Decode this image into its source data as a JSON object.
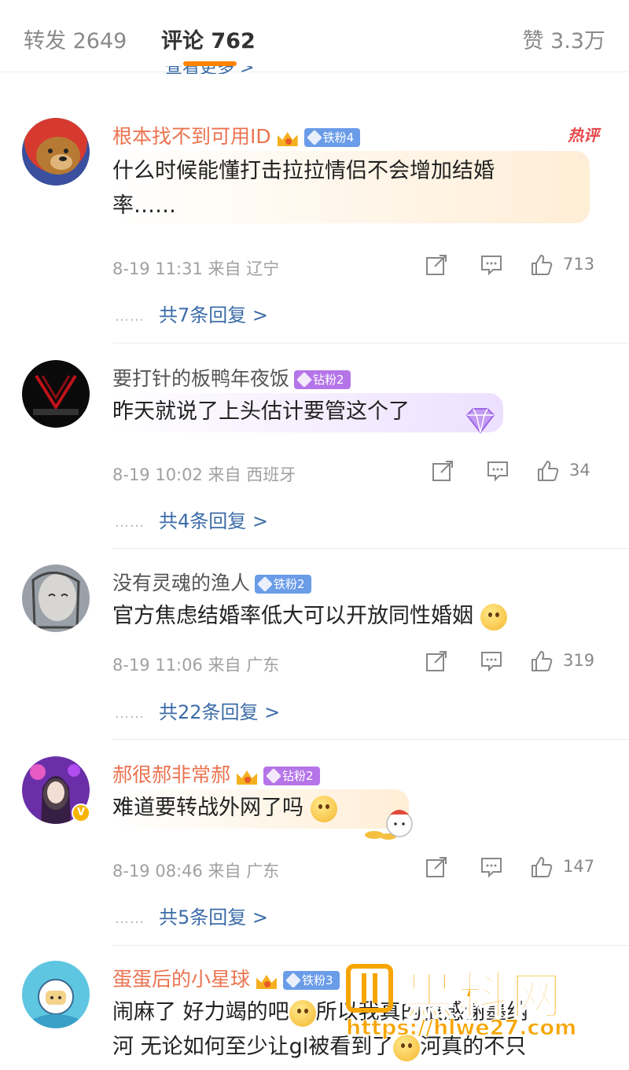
{
  "tabs": {
    "forward": "转发 2649",
    "comments": "评论 762",
    "likes": "赞 3.3万"
  },
  "peek_text": "查看更多 >",
  "hot_label": "热评",
  "comments": [
    {
      "username": "根本找不到可用ID",
      "badge": "铁粉4",
      "text": "什么时候能懂打击拉拉情侣不会增加结婚率……",
      "meta": "8-19 11:31 来自 辽宁",
      "likes": "713",
      "replies": "共7条回复 >"
    },
    {
      "username": "要打针的板鸭年夜饭",
      "badge": "钻粉2",
      "text": "昨天就说了上头估计要管这个了",
      "meta": "8-19 10:02 来自 西班牙",
      "likes": "34",
      "replies": "共4条回复 >"
    },
    {
      "username": "没有灵魂的渔人",
      "badge": "铁粉2",
      "text": "官方焦虑结婚率低大可以开放同性婚姻",
      "meta": "8-19 11:06 来自 广东",
      "likes": "319",
      "replies": "共22条回复 >"
    },
    {
      "username": "郝很郝非常郝",
      "badge": "钻粉2",
      "text": "难道要转战外网了吗",
      "meta": "8-19 08:46 来自 广东",
      "likes": "147",
      "replies": "共5条回复 >"
    },
    {
      "username": "蛋蛋后的小星球",
      "badge": "铁粉3",
      "text_line1": "闹麻了 好力竭的吧",
      "text_line1b": "所以我真的很感谢墨纳",
      "text_line2": "河 无论如何至少让gl被看到了",
      "text_line2b": "河真的不只"
    }
  ],
  "watermark": {
    "title": "黑料网",
    "url": "https://hlwe27.com"
  },
  "colors": {
    "accent": "#ff8200",
    "link": "#3b6ca8",
    "username_vip": "#eb7350",
    "hot": "#e8474a",
    "watermark": "#f7a500"
  }
}
